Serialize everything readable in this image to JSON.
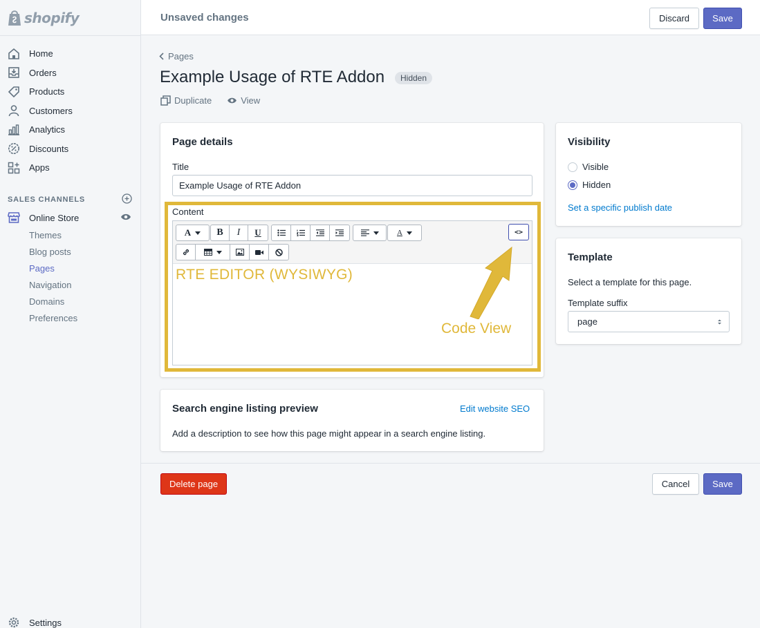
{
  "brand": {
    "name": "shopify",
    "accent": "#5c6ac4",
    "highlight": "#e0b83a",
    "link": "#007ace",
    "danger": "#de3618"
  },
  "sidebar": {
    "items": [
      {
        "label": "Home",
        "icon": "home-icon"
      },
      {
        "label": "Orders",
        "icon": "orders-icon"
      },
      {
        "label": "Products",
        "icon": "tag-icon"
      },
      {
        "label": "Customers",
        "icon": "person-icon"
      },
      {
        "label": "Analytics",
        "icon": "bar-chart-icon"
      },
      {
        "label": "Discounts",
        "icon": "discount-icon"
      },
      {
        "label": "Apps",
        "icon": "apps-icon"
      }
    ],
    "sales_channels_label": "SALES CHANNELS",
    "online_store": "Online Store",
    "sub_items": [
      "Themes",
      "Blog posts",
      "Pages",
      "Navigation",
      "Domains",
      "Preferences"
    ],
    "active_sub": "Pages",
    "settings": "Settings"
  },
  "topbar": {
    "title": "Unsaved changes",
    "discard": "Discard",
    "save": "Save"
  },
  "page": {
    "breadcrumb": "Pages",
    "title": "Example Usage of RTE Addon",
    "badge": "Hidden",
    "duplicate": "Duplicate",
    "view": "View"
  },
  "details": {
    "heading": "Page details",
    "title_label": "Title",
    "title_value": "Example Usage of RTE Addon",
    "content_label": "Content",
    "editor_text": "RTE EDITOR (WYSIWYG)",
    "annotation": "Code View",
    "code_button": "<>"
  },
  "seo": {
    "heading": "Search engine listing preview",
    "edit_link": "Edit website SEO",
    "description": "Add a description to see how this page might appear in a search engine listing."
  },
  "visibility": {
    "heading": "Visibility",
    "options": [
      "Visible",
      "Hidden"
    ],
    "selected": "Hidden",
    "publish_link": "Set a specific publish date"
  },
  "template": {
    "heading": "Template",
    "description": "Select a template for this page.",
    "suffix_label": "Template suffix",
    "suffix_value": "page"
  },
  "footer": {
    "delete": "Delete page",
    "cancel": "Cancel",
    "save": "Save"
  }
}
